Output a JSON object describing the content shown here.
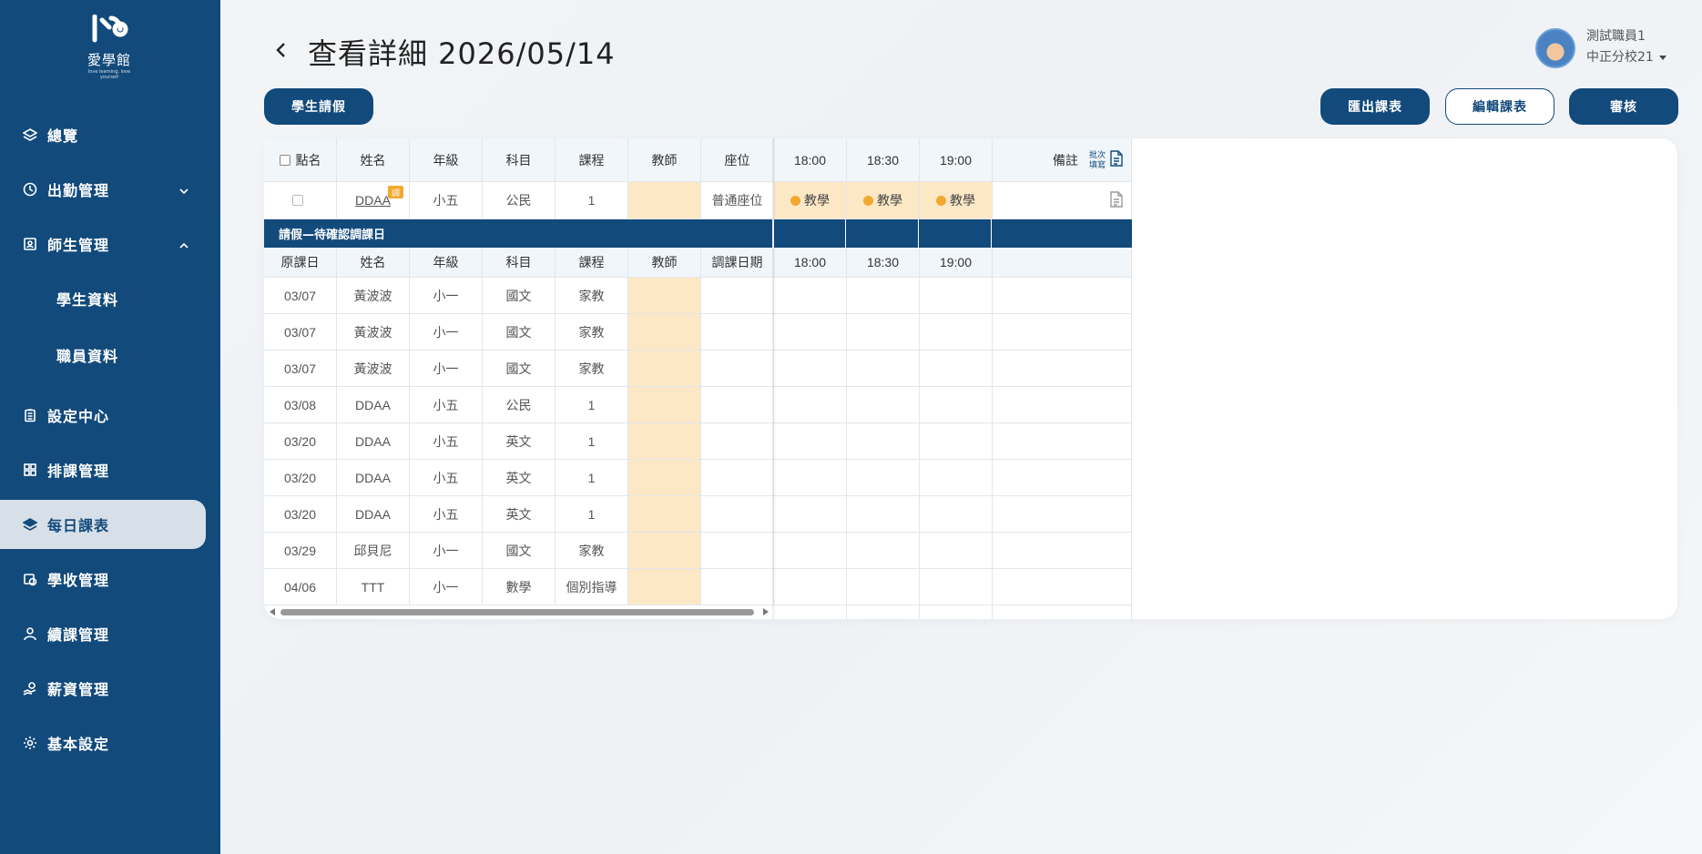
{
  "logo": {
    "mark": "I/⁴⁴",
    "name": "愛學館",
    "tagline": "love learning, love yourself"
  },
  "sidebar": {
    "items": [
      {
        "label": "總覽",
        "icon": "layers-icon"
      },
      {
        "label": "出勤管理",
        "icon": "clock-icon"
      },
      {
        "label": "師生管理",
        "icon": "id-card-icon"
      },
      {
        "label": "學生資料"
      },
      {
        "label": "職員資料"
      },
      {
        "label": "設定中心",
        "icon": "clipboard-icon"
      },
      {
        "label": "排課管理",
        "icon": "grid-icon"
      },
      {
        "label": "每日課表",
        "icon": "stack-icon"
      },
      {
        "label": "學收管理",
        "icon": "money-icon"
      },
      {
        "label": "續課管理",
        "icon": "user-icon"
      },
      {
        "label": "薪資管理",
        "icon": "hand-coin-icon"
      },
      {
        "label": "基本設定",
        "icon": "gear-icon"
      }
    ]
  },
  "header": {
    "title": "查看詳細 2026/05/14",
    "user_name": "測試職員1",
    "user_branch": "中正分校21"
  },
  "buttons": {
    "leave": "學生請假",
    "export": "匯出課表",
    "edit": "編輯課表",
    "review": "審核"
  },
  "table": {
    "headers": [
      "點名",
      "姓名",
      "年級",
      "科目",
      "課程",
      "教師",
      "座位",
      "18:00",
      "18:30",
      "19:00",
      "備註"
    ],
    "batch_label_1": "批次",
    "batch_label_2": "填寫",
    "row": {
      "name": "DDAA",
      "badge": "調",
      "grade": "小五",
      "subject": "公民",
      "course": "1",
      "teacher": "",
      "seat": "普通座位",
      "slots": [
        "教學",
        "教學",
        "教學"
      ]
    }
  },
  "leave_section": {
    "title": "請假—待確認調課日",
    "headers": [
      "原課日",
      "姓名",
      "年級",
      "科目",
      "課程",
      "教師",
      "調課日期",
      "18:00",
      "18:30",
      "19:00"
    ],
    "rows": [
      [
        "03/07",
        "黃波波",
        "小一",
        "國文",
        "家教"
      ],
      [
        "03/07",
        "黃波波",
        "小一",
        "國文",
        "家教"
      ],
      [
        "03/07",
        "黃波波",
        "小一",
        "國文",
        "家教"
      ],
      [
        "03/08",
        "DDAA",
        "小五",
        "公民",
        "1"
      ],
      [
        "03/20",
        "DDAA",
        "小五",
        "英文",
        "1"
      ],
      [
        "03/20",
        "DDAA",
        "小五",
        "英文",
        "1"
      ],
      [
        "03/20",
        "DDAA",
        "小五",
        "英文",
        "1"
      ],
      [
        "03/29",
        "邱貝尼",
        "小一",
        "國文",
        "家教"
      ],
      [
        "04/06",
        "TTT",
        "小一",
        "數學",
        "個別指導"
      ]
    ]
  },
  "colors": {
    "primary": "#124a7c",
    "teacher_cell": "#fde8c6",
    "coin": "#f2a92f"
  }
}
